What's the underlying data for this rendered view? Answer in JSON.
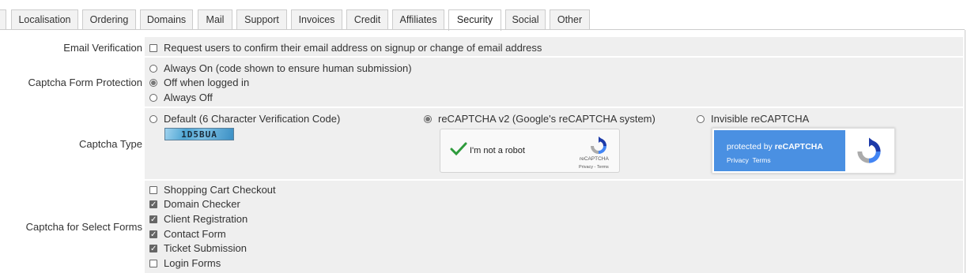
{
  "tabs": [
    {
      "label": "Localisation"
    },
    {
      "label": "Ordering"
    },
    {
      "label": "Domains"
    },
    {
      "label": "Mail"
    },
    {
      "label": "Support"
    },
    {
      "label": "Invoices"
    },
    {
      "label": "Credit"
    },
    {
      "label": "Affiliates"
    },
    {
      "label": "Security",
      "active": true
    },
    {
      "label": "Social"
    },
    {
      "label": "Other"
    }
  ],
  "email_verification": {
    "label": "Email Verification",
    "checkbox_label": "Request users to confirm their email address on signup or change of email address",
    "checked": false
  },
  "captcha_form_protection": {
    "label": "Captcha Form Protection",
    "options": [
      {
        "label": "Always On (code shown to ensure human submission)",
        "selected": false
      },
      {
        "label": "Off when logged in",
        "selected": true
      },
      {
        "label": "Always Off",
        "selected": false
      }
    ]
  },
  "captcha_type": {
    "label": "Captcha Type",
    "options": [
      {
        "label": "Default (6 Character Verification Code)",
        "selected": false
      },
      {
        "label": "reCAPTCHA v2 (Google's reCAPTCHA system)",
        "selected": true
      },
      {
        "label": "Invisible reCAPTCHA",
        "selected": false
      }
    ],
    "sample_code": "1D5BUA",
    "recaptcha_v2": {
      "checkbox_text": "I'm not a robot",
      "brand": "reCAPTCHA",
      "links": "Privacy - Terms"
    },
    "invisible": {
      "protected_prefix": "protected by ",
      "brand": "reCAPTCHA",
      "privacy": "Privacy",
      "terms": "Terms",
      "accent_color": "#4a90e2"
    }
  },
  "captcha_select_forms": {
    "label": "Captcha for Select Forms",
    "forms": [
      {
        "label": "Shopping Cart Checkout",
        "checked": false
      },
      {
        "label": "Domain Checker",
        "checked": true
      },
      {
        "label": "Client Registration",
        "checked": true
      },
      {
        "label": "Contact Form",
        "checked": true
      },
      {
        "label": "Ticket Submission",
        "checked": true
      },
      {
        "label": "Login Forms",
        "checked": false
      }
    ]
  }
}
